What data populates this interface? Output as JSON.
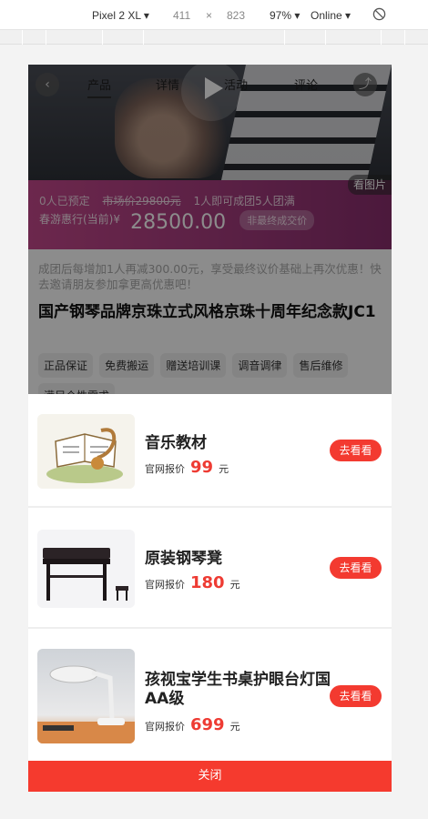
{
  "devtools": {
    "device": "Pixel 2 XL",
    "width": "411",
    "times": "×",
    "height": "823",
    "zoom": "97%",
    "network": "Online"
  },
  "hero": {
    "tabs": [
      "产品",
      "详情",
      "活动",
      "评论"
    ],
    "view_pic": "看图片"
  },
  "price": {
    "booked": "0人已预定",
    "original": "市场价29800元",
    "group": "1人即可成团5人团满",
    "label": "春游惠行(当前)",
    "currency": "¥",
    "amount": "28500.00",
    "note": "非最终成交价"
  },
  "info": {
    "desc": "成团后每增加1人再减300.00元，享受最终议价基础上再次优惠！快去邀请朋友参加拿更高优惠吧！",
    "title": "国产钢琴品牌京珠立式风格京珠十周年纪念款JC1",
    "tags": [
      "正品保证",
      "免费搬运",
      "赠送培训课",
      "调音调律",
      "售后维修",
      "满足个性需求"
    ]
  },
  "popup": {
    "items": [
      {
        "name": "音乐教材",
        "price_label": "官网报价",
        "price": "99",
        "unit": "元",
        "button": "去看看"
      },
      {
        "name": "原装钢琴凳",
        "price_label": "官网报价",
        "price": "180",
        "unit": "元",
        "button": "去看看"
      },
      {
        "name": "孩视宝学生书桌护眼台灯国AA级",
        "price_label": "官网报价",
        "price": "699",
        "unit": "元",
        "button": "去看看"
      }
    ],
    "close": "关闭"
  },
  "colors": {
    "accent": "#f53a2e",
    "price_band": "#c5488c"
  }
}
